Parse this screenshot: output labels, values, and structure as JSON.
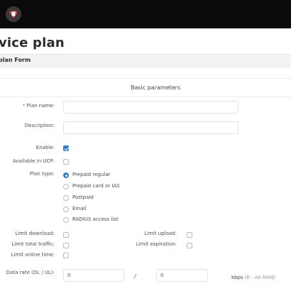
{
  "header": {
    "avatar_icon": "trash-icon",
    "avatar_color": "#e0443c"
  },
  "page": {
    "title": "vice plan",
    "subtitle": "plan Form"
  },
  "section": {
    "title": "Basic parameters"
  },
  "form": {
    "plan_name_label": "Plan name:",
    "required_mark": "*",
    "plan_name_value": "",
    "description_label": "Description:",
    "description_value": "",
    "enable_label": "Enable:",
    "enable_checked": true,
    "ucp_label": "Available in UCP:",
    "ucp_checked": false,
    "plan_type_label": "Plan type:",
    "plan_types": [
      {
        "label": "Prepaid regular",
        "selected": true
      },
      {
        "label": "Prepaid card or IAS",
        "selected": false
      },
      {
        "label": "Postpaid",
        "selected": false
      },
      {
        "label": "Email",
        "selected": false
      },
      {
        "label": "RADIUS access list",
        "selected": false
      }
    ],
    "limit_download_label": "Limit download:",
    "limit_upload_label": "Limit upload:",
    "limit_traffic_label": "Limit total traffic:",
    "limit_expiration_label": "Limit expiration:",
    "limit_online_label": "Limit online time:",
    "data_rate_label": "Data rate (DL / UL):",
    "data_rate_dl": "0",
    "data_rate_ul": "0",
    "separator": "/",
    "unit": "kbps",
    "unit_hint": "(0 - no limit)"
  },
  "colors": {
    "accent": "#2e7fd6",
    "topbar": "#0b0b0b"
  }
}
